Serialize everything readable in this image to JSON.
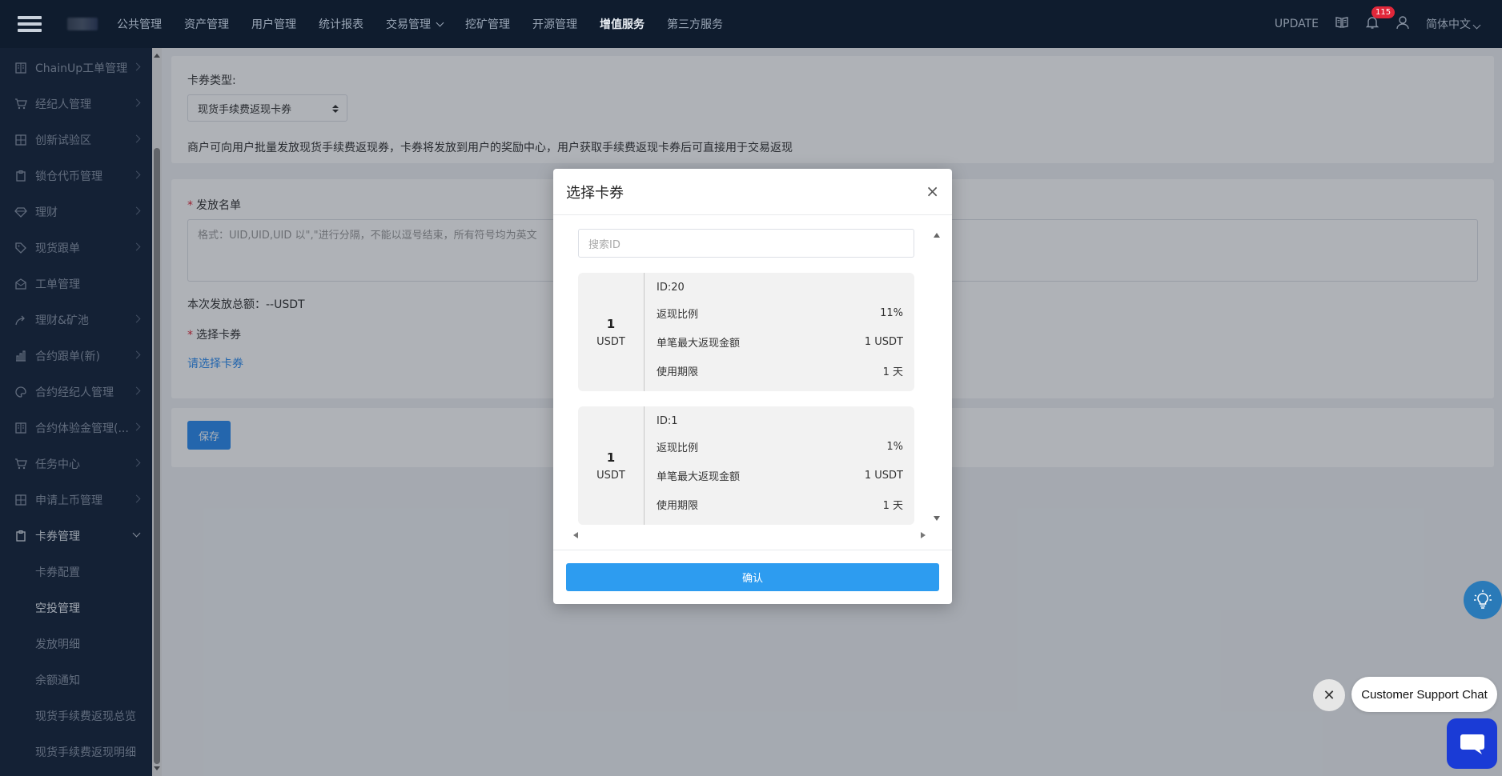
{
  "topbar": {
    "nav": [
      {
        "label": "公共管理"
      },
      {
        "label": "资产管理"
      },
      {
        "label": "用户管理"
      },
      {
        "label": "统计报表"
      },
      {
        "label": "交易管理",
        "dropdown": true
      },
      {
        "label": "挖矿管理"
      },
      {
        "label": "开源管理"
      },
      {
        "label": "增值服务",
        "active": true
      },
      {
        "label": "第三方服务"
      }
    ],
    "update_label": "UPDATE",
    "notification_count": "115",
    "language": "简体中文"
  },
  "sidebar": {
    "items": [
      {
        "label": "ChainUp工单管理",
        "icon": "book-icon"
      },
      {
        "label": "经纪人管理",
        "icon": "cart-icon"
      },
      {
        "label": "创新试验区",
        "icon": "grid-icon"
      },
      {
        "label": "锁仓代币管理",
        "icon": "clipboard-icon"
      },
      {
        "label": "理财",
        "icon": "diamond-icon"
      },
      {
        "label": "现货跟单",
        "icon": "tag-icon"
      },
      {
        "label": "工单管理",
        "icon": "mail-icon"
      },
      {
        "label": "理财&矿池",
        "icon": "share-icon"
      },
      {
        "label": "合约跟单(新)",
        "icon": "bar-chart-icon"
      },
      {
        "label": "合约经纪人管理",
        "icon": "palette-icon"
      },
      {
        "label": "合约体验金管理(...",
        "icon": "book-icon"
      },
      {
        "label": "任务中心",
        "icon": "cart-icon"
      },
      {
        "label": "申请上币管理",
        "icon": "grid-icon"
      },
      {
        "label": "卡券管理",
        "icon": "clipboard-icon",
        "open": true
      }
    ],
    "sub_items": [
      {
        "label": "卡券配置"
      },
      {
        "label": "空投管理",
        "active": true
      },
      {
        "label": "发放明细"
      },
      {
        "label": "余额通知"
      },
      {
        "label": "现货手续费返现总览"
      },
      {
        "label": "现货手续费返现明细"
      }
    ]
  },
  "form": {
    "coupon_type_label": "卡券类型:",
    "coupon_type_value": "现货手续费返现卡券",
    "description": "商户可向用户批量发放现货手续费返现券，卡券将发放到用户的奖励中心，用户获取手续费返现卡券后可直接用于交易返现",
    "list_label": "发放名单",
    "list_placeholder": "格式：UID,UID,UID 以\",\"进行分隔，不能以逗号结束，所有符号均为英文",
    "total_label": "本次发放总额：--USDT",
    "select_label": "选择卡券",
    "select_link": "请选择卡券",
    "save_label": "保存"
  },
  "modal": {
    "title": "选择卡券",
    "search_placeholder": "搜索ID",
    "confirm_label": "确认",
    "coupons": [
      {
        "amount": "1",
        "unit": "USDT",
        "id": "ID:20",
        "rate_label": "返现比例",
        "rate_value": "11%",
        "max_label": "单笔最大返现金额",
        "max_value": "1 USDT",
        "period_label": "使用期限",
        "period_value": "1 天"
      },
      {
        "amount": "1",
        "unit": "USDT",
        "id": "ID:1",
        "rate_label": "返现比例",
        "rate_value": "1%",
        "max_label": "单笔最大返现金额",
        "max_value": "1 USDT",
        "period_label": "使用期限",
        "period_value": "1 天"
      }
    ]
  },
  "support_chat": {
    "label": "Customer Support Chat"
  }
}
